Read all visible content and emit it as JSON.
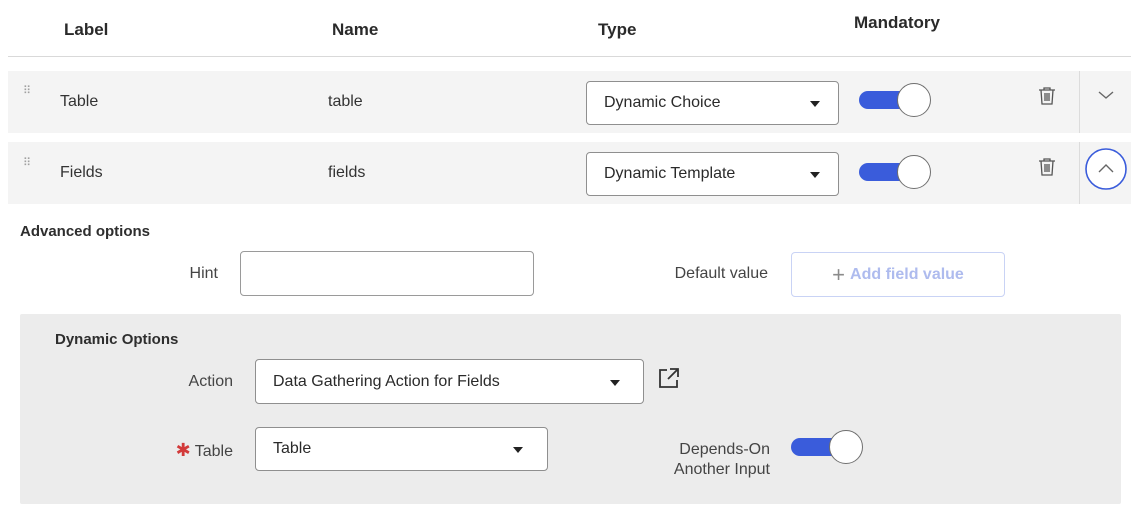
{
  "columns": {
    "label": "Label",
    "name": "Name",
    "type": "Type",
    "mandatory": "Mandatory"
  },
  "rows": [
    {
      "label": "Table",
      "name": "table",
      "type": "Dynamic Choice",
      "mandatory": true,
      "expanded": false
    },
    {
      "label": "Fields",
      "name": "fields",
      "type": "Dynamic Template",
      "mandatory": true,
      "expanded": true
    }
  ],
  "advanced": {
    "title": "Advanced options",
    "hint_label": "Hint",
    "hint_value": "",
    "default_value_label": "Default value",
    "add_field_value_label": "Add field value"
  },
  "dynamic": {
    "title": "Dynamic Options",
    "action_label": "Action",
    "action_value": "Data Gathering Action for Fields",
    "table_label": "Table",
    "table_value": "Table",
    "depends_on_label_line1": "Depends-On",
    "depends_on_label_line2": "Another Input",
    "depends_on": true
  },
  "colors": {
    "toggle_on": "#3a5cdb",
    "expander_active": "#3a5cdb",
    "required": "#d23a3a",
    "add_button_text": "#aebbee"
  },
  "icons": {
    "drag": "drag-handle-icon",
    "delete": "trash-icon",
    "collapse": "chevron-up-icon",
    "expand": "chevron-down-icon",
    "open_external": "external-link-icon",
    "dropdown": "caret-down-icon"
  }
}
